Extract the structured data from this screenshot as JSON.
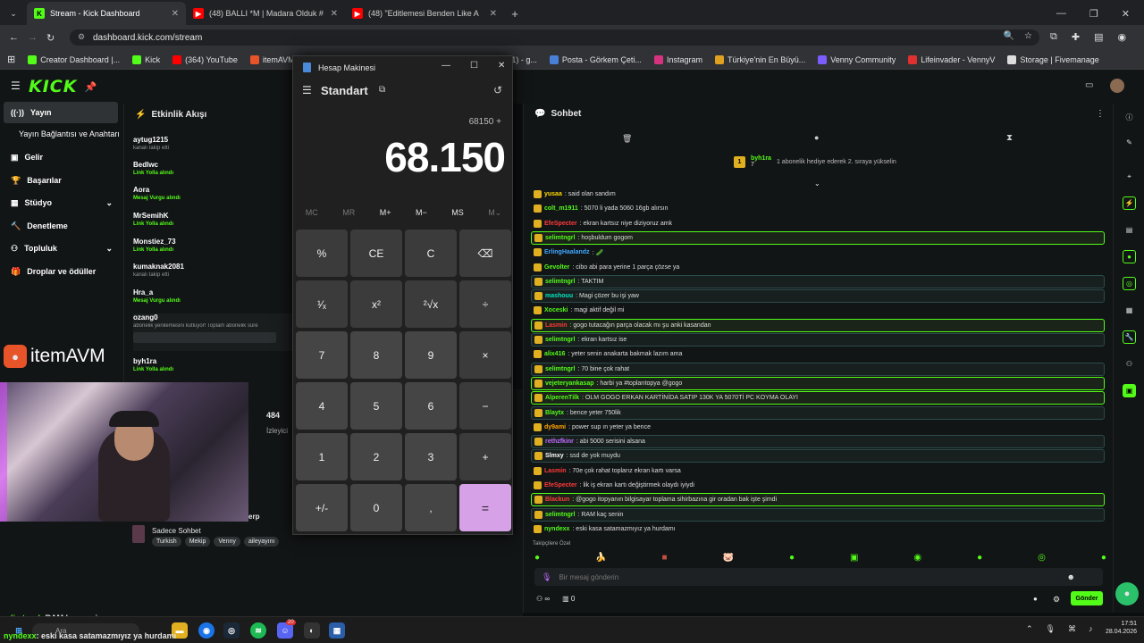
{
  "browser": {
    "tabs": [
      {
        "title": "Stream - Kick Dashboard",
        "fav": "K"
      },
      {
        "title": "(48) BALLI *M | Madara Olduk #",
        "fav": "▶"
      },
      {
        "title": "(48) \"Editlemesi Benden Like A",
        "fav": "▶"
      }
    ],
    "url": "dashboard.kick.com/stream",
    "bookmarks": [
      "Creator Dashboard |...",
      "Kick",
      "(364) YouTube",
      "itemAVM | Türk...",
      "en Kutusu (1) - g...",
      "Posta - Görkem Çeti...",
      "Instagram",
      "Türkiye'nin En Büyü...",
      "Venny Community",
      "Lifeinvader - VennyV",
      "Storage | Fivemanage"
    ]
  },
  "colors": {
    "accent": "#53fc18",
    "eq": "#d7a1e8"
  },
  "sidebar": {
    "items": [
      {
        "label": "Yayın",
        "icon": "broadcast-icon"
      },
      {
        "label": "Yayın Bağlantısı ve Anahtarı",
        "icon": ""
      },
      {
        "label": "Gelir",
        "icon": "money-icon"
      },
      {
        "label": "Başarılar",
        "icon": "trophy-icon"
      },
      {
        "label": "Stüdyo",
        "icon": "studio-icon"
      },
      {
        "label": "Denetleme",
        "icon": "hammer-icon"
      },
      {
        "label": "Topluluk",
        "icon": "community-icon"
      },
      {
        "label": "Droplar ve ödüller",
        "icon": "gift-icon"
      }
    ]
  },
  "feed": {
    "title": "Etkinlik Akışı",
    "events": [
      {
        "user": "aytug1215",
        "sub": "kanalı takip etti",
        "type": "follow"
      },
      {
        "user": "Bedlwc",
        "sub": "Link Yolla alındı",
        "type": "reward"
      },
      {
        "user": "Aora",
        "sub": "Mesaj Vurgu alındı",
        "type": "reward"
      },
      {
        "user": "MrSemihK",
        "sub": "Link Yolla alındı",
        "type": "reward"
      },
      {
        "user": "Monstiez_73",
        "sub": "Link Yolla alındı",
        "type": "reward"
      },
      {
        "user": "kumaknak2081",
        "sub": "kanalı takip etti",
        "type": "follow"
      },
      {
        "user": "Hra_a",
        "sub": "Mesaj Vurgu alındı",
        "type": "reward"
      },
      {
        "user": "ozang0",
        "sub": "abonelik yenilemesini kutluyor! Toplam abonelik süre",
        "type": "sub"
      },
      {
        "user": "byh1ra",
        "sub": "Link Yolla alındı",
        "type": "reward"
      }
    ]
  },
  "stream": {
    "viewers": "484",
    "viewers_label": "İzleyici",
    "chat_mode": "Sadece Sohbet",
    "tags": [
      "Turkish",
      "Mekip",
      "Venny",
      "aileyayını"
    ],
    "title_frag": "erp",
    "ad_text": "itemAVM"
  },
  "calc": {
    "app": "Hesap Makinesi",
    "mode": "Standart",
    "expr": "68150 +",
    "display": "68.150",
    "memory": [
      "MC",
      "MR",
      "M+",
      "M−",
      "MS",
      "M⌄"
    ],
    "keys": [
      "%",
      "CE",
      "C",
      "⌫",
      "¹⁄ₓ",
      "x²",
      "²√x",
      "÷",
      "7",
      "8",
      "9",
      "×",
      "4",
      "5",
      "6",
      "−",
      "1",
      "2",
      "3",
      "+",
      "+/-",
      "0",
      ",",
      "="
    ]
  },
  "chat": {
    "title": "Sohbet",
    "pinned_user": "byh1ra",
    "pinned_count": "7",
    "pinned_text": "1 abonelik hediye ederek 2. sıraya yükselin",
    "messages": [
      {
        "user": "yusaa",
        "text": ": said olan sandım",
        "color": "#ffd800",
        "style": ""
      },
      {
        "user": "colt_m1911",
        "text": ": 5070 li yada 5060 16gb alırsın",
        "color": "#53fc18",
        "style": ""
      },
      {
        "user": "EfeSpecter",
        "text": ": ekran kartsız niye diziyoruz amk",
        "color": "#ff3a3a",
        "style": ""
      },
      {
        "user": "selimtngrl",
        "text": ": hoşbuldum gogom",
        "color": "#53fc18",
        "style": "hl"
      },
      {
        "user": "ErlingHaalandz",
        "text": ": 🥒",
        "color": "#3fa9ff",
        "style": ""
      },
      {
        "user": "Gevolter",
        "text": ": cibo abi para yerine 1 parça çözse ya",
        "color": "#53fc18",
        "style": ""
      },
      {
        "user": "selimtngrl",
        "text": ": TAKTIM",
        "color": "#53fc18",
        "style": "hl2"
      },
      {
        "user": "mashouu",
        "text": ": Magi çözer bu işi yaw",
        "color": "#00e5c0",
        "style": "hl2"
      },
      {
        "user": "Xoceski",
        "text": ": magi aktif değil mi",
        "color": "#53fc18",
        "style": ""
      },
      {
        "user": "Lasmin",
        "text": ": gogo tutacağın parça olacak mı şu anki kasandan",
        "color": "#ff3a3a",
        "style": "hl"
      },
      {
        "user": "selimtngrl",
        "text": ": ekran kartsız ise",
        "color": "#53fc18",
        "style": "hl2"
      },
      {
        "user": "alix416",
        "text": ": yeter senin anakarta bakmak lazım ama",
        "color": "#53fc18",
        "style": ""
      },
      {
        "user": "selimtngrl",
        "text": ": 70 bine çok rahat",
        "color": "#53fc18",
        "style": "hl2"
      },
      {
        "user": "vejeteryankasap",
        "text": ": harbi ya #toplarıtopya @gogo",
        "color": "#53fc18",
        "style": "hl"
      },
      {
        "user": "AlperenTilk",
        "text": ": OLM GOGO ERKAN KARTİNİDA SATIP 130K YA 5070Tİ PC KOYMA OLAYI",
        "color": "#53fc18",
        "style": "hl"
      },
      {
        "user": "Blaytx",
        "text": ": bence yeter 750lik",
        "color": "#53fc18",
        "style": "hl2"
      },
      {
        "user": "dy9ami",
        "text": ": power sup ın yeter ya bence",
        "color": "#ffa500",
        "style": ""
      },
      {
        "user": "rethzfkinr",
        "text": ": abi 5000 serisini alsana",
        "color": "#c06bff",
        "style": "hl2"
      },
      {
        "user": "Slmxy",
        "text": ": ssd de yok muydu",
        "color": "#ffffff",
        "style": "hl2"
      },
      {
        "user": "Lasmin",
        "text": ": 70e çok rahat toplarız ekran kartı varsa",
        "color": "#ff3a3a",
        "style": ""
      },
      {
        "user": "EfeSpecter",
        "text": ": lik iş ekran kartı değiştirmek olaydı iyiydi",
        "color": "#ff3a3a",
        "style": ""
      },
      {
        "user": "Blackun",
        "text": ": @gogo itopyanın bilgisayar toplama sihirbazına gir oradan bak işte şimdi",
        "color": "#ff3a3a",
        "style": "hl"
      },
      {
        "user": "selimtngrl",
        "text": ": RAM kaç senin",
        "color": "#53fc18",
        "style": "hl2"
      },
      {
        "user": "nyndexx",
        "text": ": eski kasa satamazmıyız ya hurdamı",
        "color": "#53fc18",
        "style": ""
      }
    ],
    "followers_only": "Takipçilere Özel",
    "placeholder": "Bir mesaj gönderin",
    "send": "Gönder",
    "counter_left": "∞",
    "counter_right": "0"
  },
  "overlay": {
    "l1_user": "selimtngrl",
    "l1_text": ": RAM kaç senin",
    "l2_user": "nyndexx",
    "l2_text": ": eski kasa satamazmıyız ya hurdamı"
  },
  "taskbar": {
    "search": "Ara",
    "time": "17:51",
    "date": "28.04.2026",
    "badge": "20"
  }
}
